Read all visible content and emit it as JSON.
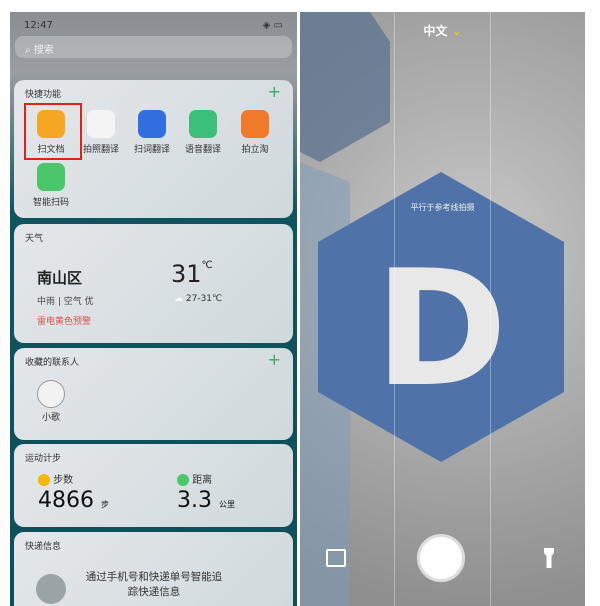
{
  "status": {
    "time": "12:47"
  },
  "search": {
    "placeholder": "搜索"
  },
  "quick": {
    "title": "快捷功能",
    "apps": [
      {
        "label": "扫文档",
        "color": "#f5a623"
      },
      {
        "label": "拍照翻译",
        "color": "#f4f4f4"
      },
      {
        "label": "扫词翻译",
        "color": "#2f6fe0"
      },
      {
        "label": "语音翻译",
        "color": "#3bbf7a"
      },
      {
        "label": "拍立淘",
        "color": "#f07a2a"
      },
      {
        "label": "智能扫码",
        "color": "#4cc66a"
      }
    ]
  },
  "weather": {
    "title": "天气",
    "district": "南山区",
    "temp": "31",
    "unit": "℃",
    "condition": "中雨 | 空气 优",
    "range": "27-31℃",
    "alert": "雷电黄色预警"
  },
  "contacts": {
    "title": "收藏的联系人",
    "items": [
      {
        "name": "小歌"
      }
    ]
  },
  "sport": {
    "title": "运动计步",
    "steps_label": "步数",
    "steps": "4866",
    "steps_unit": "步",
    "distance_label": "距离",
    "distance": "3.3",
    "distance_unit": "公里"
  },
  "express": {
    "title": "快递信息",
    "message": "通过手机号和快递单号智能追踪快递信息"
  },
  "camera": {
    "language": "中文",
    "hint": "平行于参考线拍摄",
    "letter": "D",
    "accent": "#f0c020"
  }
}
